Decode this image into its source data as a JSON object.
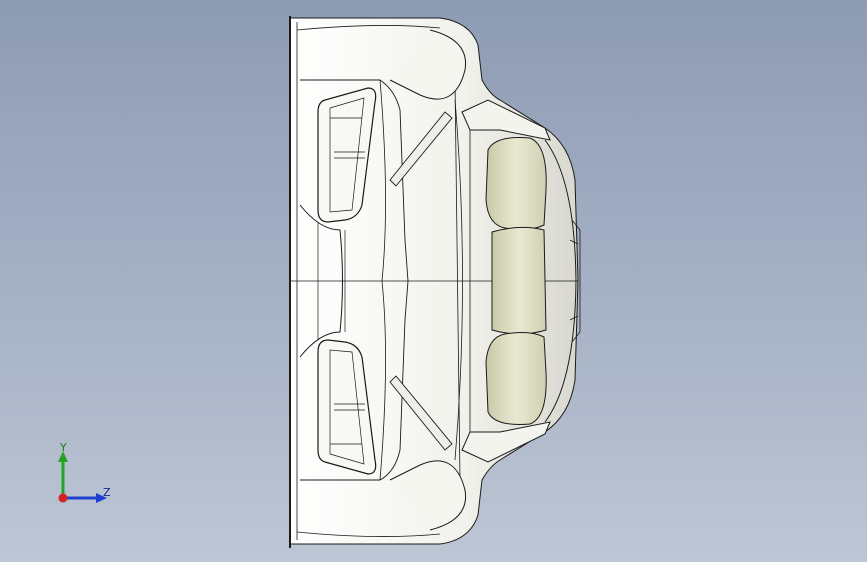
{
  "view": {
    "background_top": "#8d9bb4",
    "background_bottom": "#bdc6d4",
    "body_color": "#f4f4ee",
    "seat_color": "#dcdcc0",
    "edge_color": "#1a1a1a"
  },
  "triad": {
    "y_label": "Y",
    "z_label": "Z",
    "y_color": "#22a522",
    "z_color": "#1f3fd1",
    "x_color": "#d22222"
  }
}
